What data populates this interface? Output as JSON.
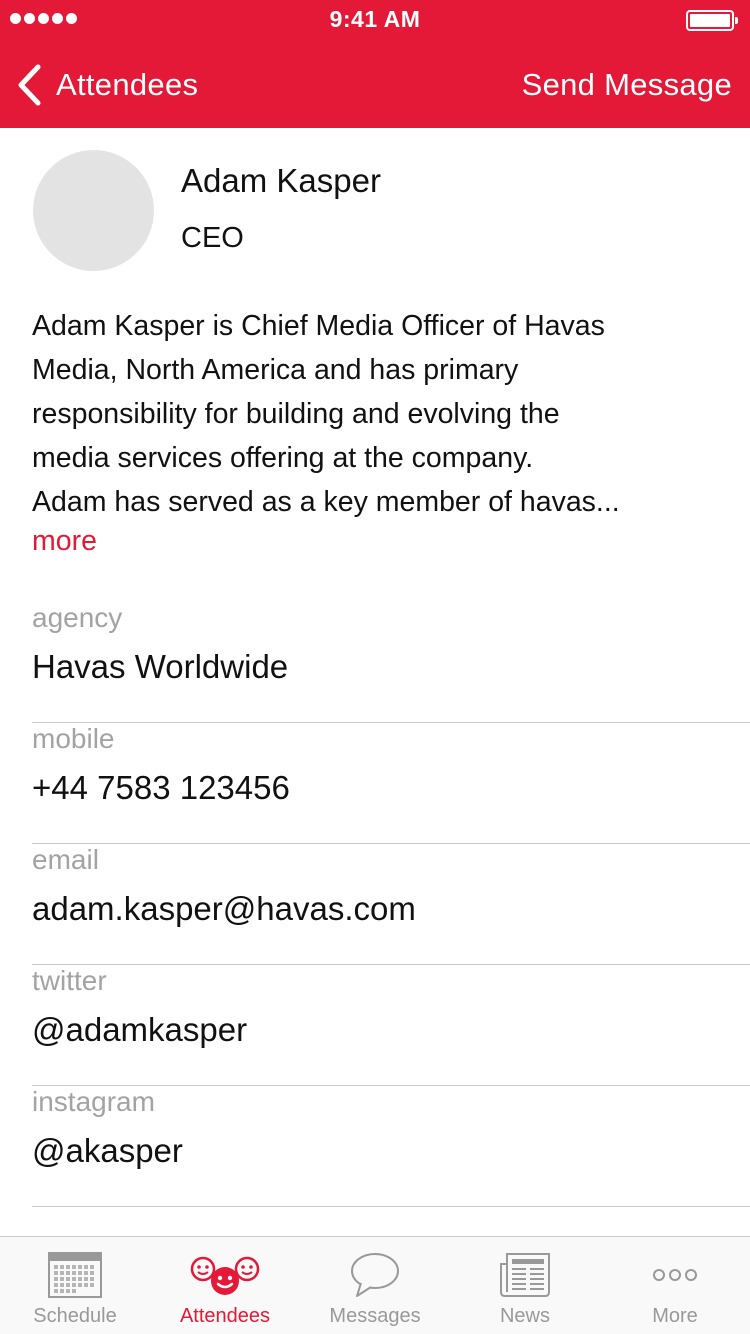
{
  "status_bar": {
    "time": "9:41 AM"
  },
  "nav": {
    "back_label": "Attendees",
    "action_label": "Send Message"
  },
  "profile": {
    "name": "Adam Kasper",
    "title": "CEO",
    "bio_lines": [
      "Adam Kasper is Chief Media Officer of Havas",
      "Media, North America and has primary",
      "responsibility for building and evolving the",
      "media services offering at the company.",
      "Adam has served as a key member of havas..."
    ],
    "more_label": "more"
  },
  "fields": [
    {
      "label": "agency",
      "value": "Havas Worldwide"
    },
    {
      "label": "mobile",
      "value": "+44 7583 123456"
    },
    {
      "label": "email",
      "value": "adam.kasper@havas.com"
    },
    {
      "label": "twitter",
      "value": "@adamkasper"
    },
    {
      "label": "instagram",
      "value": "@akasper"
    }
  ],
  "tab_bar": {
    "active_tab": "Attendees",
    "tabs": [
      {
        "label": "Schedule",
        "icon": "calendar-icon"
      },
      {
        "label": "Attendees",
        "icon": "attendees-icon"
      },
      {
        "label": "Messages",
        "icon": "speech-bubble-icon"
      },
      {
        "label": "News",
        "icon": "newspaper-icon"
      },
      {
        "label": "More",
        "icon": "more-dots-icon"
      }
    ]
  },
  "colors": {
    "brand": "#e31937",
    "label_gray": "#a3a3a3",
    "tab_inactive": "#999999",
    "avatar_placeholder": "#e3e3e3"
  }
}
